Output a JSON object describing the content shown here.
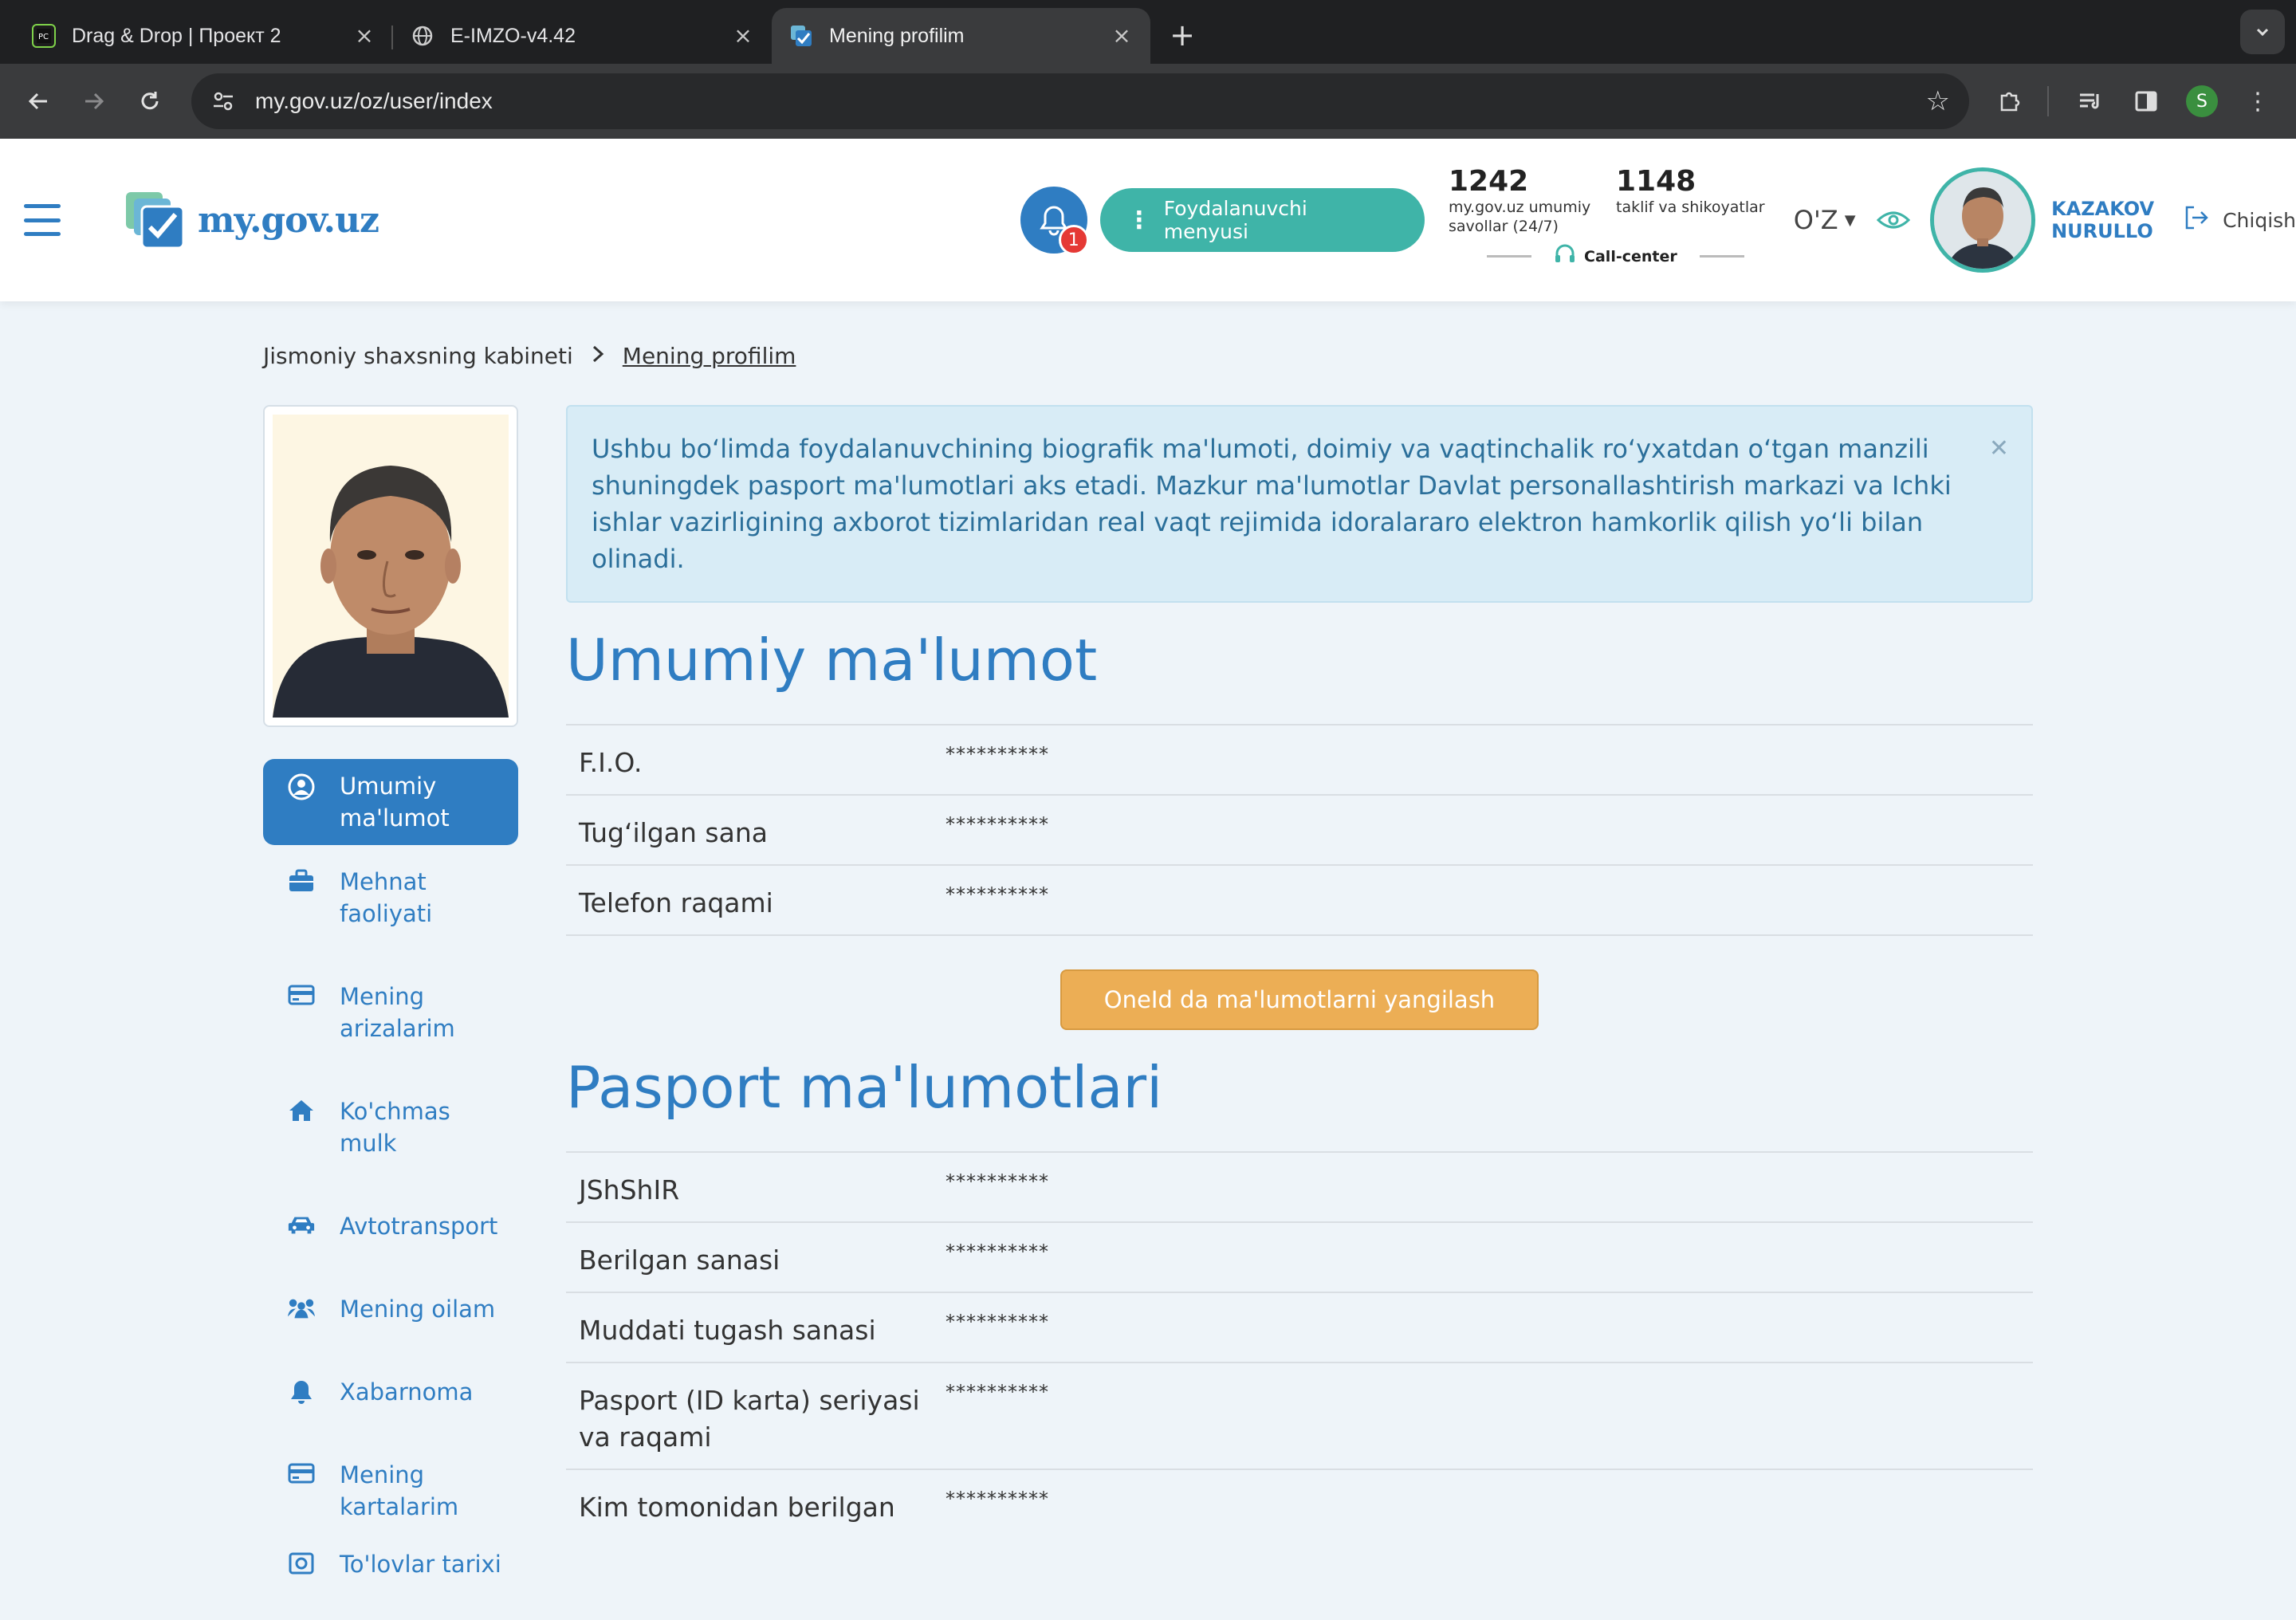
{
  "browser": {
    "tabs": [
      {
        "title": "Drag & Drop | Проект 2",
        "active": false
      },
      {
        "title": "E-IMZO-v4.42",
        "active": false
      },
      {
        "title": "Mening profilim",
        "active": true
      }
    ],
    "url": "my.gov.uz/oz/user/index",
    "profile_initial": "S"
  },
  "header": {
    "logo_text": "my.gov.uz",
    "notification_count": "1",
    "user_menu_label": "Foydalanuvchi menyusi",
    "stats": [
      {
        "num": "1242",
        "label": "my.gov.uz umumiy savollar (24/7)"
      },
      {
        "num": "1148",
        "label": "taklif va shikoyatlar"
      }
    ],
    "call_center": "Call-center",
    "language": "O'Z",
    "user_name_first": "KAZAKOV",
    "user_name_second": "NURULLO",
    "logout": "Chiqish",
    "accent": "#2f7dc2",
    "teal": "#3fb4a8"
  },
  "breadcrumb": {
    "root": "Jismoniy shaxsning kabineti",
    "current": "Mening profilim"
  },
  "sidebar": {
    "items": [
      {
        "label": "Umumiy ma'lumot",
        "icon": "user-circle-icon",
        "active": true
      },
      {
        "label": "Mehnat faoliyati",
        "icon": "briefcase-icon"
      },
      {
        "label": "Mening arizalarim",
        "icon": "card-icon"
      },
      {
        "label": "Ko'chmas mulk",
        "icon": "home-icon"
      },
      {
        "label": "Avtotransport",
        "icon": "car-icon"
      },
      {
        "label": "Mening oilam",
        "icon": "family-icon"
      },
      {
        "label": "Xabarnoma",
        "icon": "bell-icon"
      },
      {
        "label": "Mening kartalarim",
        "icon": "card-icon"
      },
      {
        "label": "To'lovlar tarixi",
        "icon": "history-icon"
      }
    ]
  },
  "main": {
    "notice": "Ushbu bo‘limda foydalanuvchining biografik ma'lumoti, doimiy va vaqtinchalik ro‘yxatdan o‘tgan manzili shuningdek pasport ma'lumotlari aks etadi. Mazkur ma'lumotlar Davlat personallashtirish markazi va Ichki ishlar vazirligining axborot tizimlaridan real vaqt rejimida idoralararo elektron hamkorlik qilish yo‘li bilan olinadi.",
    "general": {
      "title": "Umumiy ma'lumot",
      "rows": [
        {
          "label": "F.I.O.",
          "value": "**********"
        },
        {
          "label": "Tug‘ilgan sana",
          "value": "**********"
        },
        {
          "label": "Telefon raqami",
          "value": "**********"
        }
      ],
      "update_button": "OneId da ma'lumotlarni yangilash"
    },
    "passport": {
      "title": "Pasport ma'lumotlari",
      "rows": [
        {
          "label": "JShShIR",
          "value": "**********"
        },
        {
          "label": "Berilgan sanasi",
          "value": "**********"
        },
        {
          "label": "Muddati tugash sanasi",
          "value": "**********"
        },
        {
          "label": "Pasport (ID karta) seriyasi va raqami",
          "value": "**********"
        },
        {
          "label": "Kim tomonidan berilgan",
          "value": "**********"
        }
      ]
    }
  }
}
